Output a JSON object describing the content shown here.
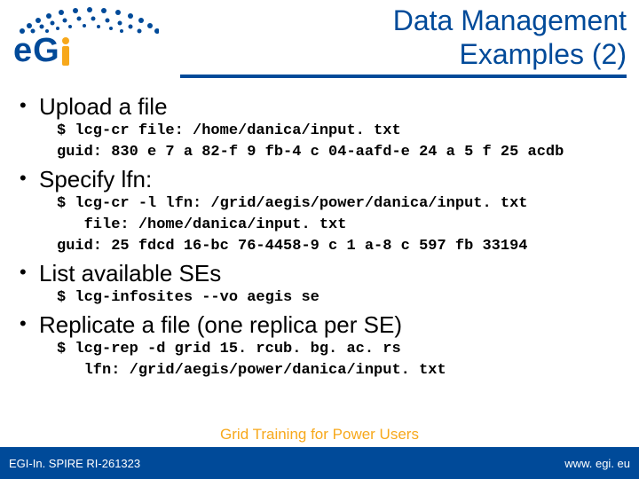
{
  "title_line1": "Data Management",
  "title_line2": "Examples (2)",
  "logo": {
    "e": "e",
    "g": "G",
    "brand": "EGI"
  },
  "bullets": [
    {
      "heading": "Upload a file",
      "code": [
        "$ lcg-cr file: /home/danica/input. txt",
        "guid: 830 e 7 a 82-f 9 fb-4 c 04-aafd-e 24 a 5 f 25 acdb"
      ]
    },
    {
      "heading": "Specify lfn:",
      "code": [
        "$ lcg-cr -l lfn: /grid/aegis/power/danica/input. txt",
        "   file: /home/danica/input. txt",
        "guid: 25 fdcd 16-bc 76-4458-9 c 1 a-8 c 597 fb 33194"
      ]
    },
    {
      "heading": "List available SEs",
      "code": [
        "$ lcg-infosites --vo aegis se"
      ]
    },
    {
      "heading": "Replicate a file (one replica per SE)",
      "code": [
        "$ lcg-rep -d grid 15. rcub. bg. ac. rs",
        "   lfn: /grid/aegis/power/danica/input. txt"
      ]
    }
  ],
  "footer": {
    "left": "EGI-In. SPIRE RI-261323",
    "center": "Grid Training for Power Users",
    "right": "www. egi. eu"
  }
}
